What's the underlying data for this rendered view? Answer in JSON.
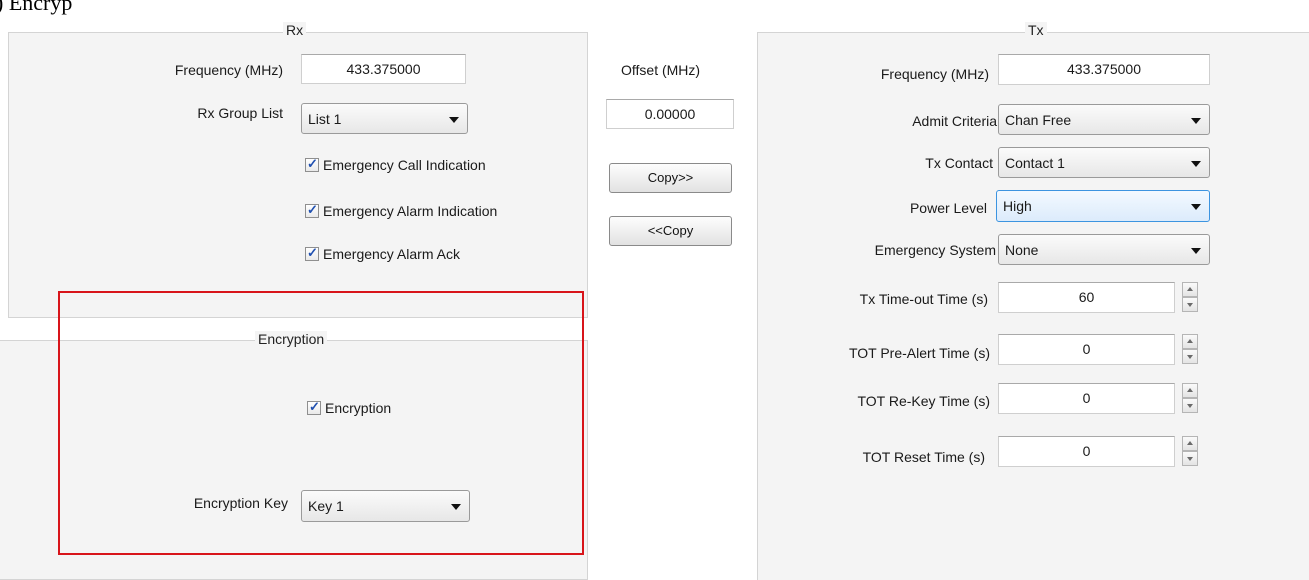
{
  "top_fragment": ") Encryp",
  "rx": {
    "title": "Rx",
    "frequency_label": "Frequency (MHz)",
    "frequency_value": "433.375000",
    "group_list_label": "Rx Group List",
    "group_list_value": "List 1",
    "checkboxes": [
      {
        "label": "Emergency Call Indication",
        "checked": true
      },
      {
        "label": "Emergency Alarm Indication",
        "checked": true
      },
      {
        "label": "Emergency Alarm Ack",
        "checked": true
      }
    ]
  },
  "offset": {
    "label": "Offset (MHz)",
    "value": "0.00000",
    "copy_right_label": "Copy>>",
    "copy_left_label": "<<Copy"
  },
  "encryption": {
    "title": "Encryption",
    "checkbox_label": "Encryption",
    "checked": true,
    "key_label": "Encryption Key",
    "key_value": "Key 1",
    "highlight_color": "#d8141a"
  },
  "tx": {
    "title": "Tx",
    "frequency_label": "Frequency (MHz)",
    "frequency_value": "433.375000",
    "admit_label": "Admit Criteria",
    "admit_value": "Chan Free",
    "contact_label": "Tx Contact",
    "contact_value": "Contact 1",
    "power_label": "Power Level",
    "power_value": "High",
    "emergency_label": "Emergency System",
    "emergency_value": "None",
    "timeout_label": "Tx Time-out Time (s)",
    "timeout_value": "60",
    "prealert_label": "TOT Pre-Alert Time (s)",
    "prealert_value": "0",
    "rekey_label": "TOT Re-Key Time (s)",
    "rekey_value": "0",
    "reset_label": "TOT Reset Time (s)",
    "reset_value": "0"
  }
}
